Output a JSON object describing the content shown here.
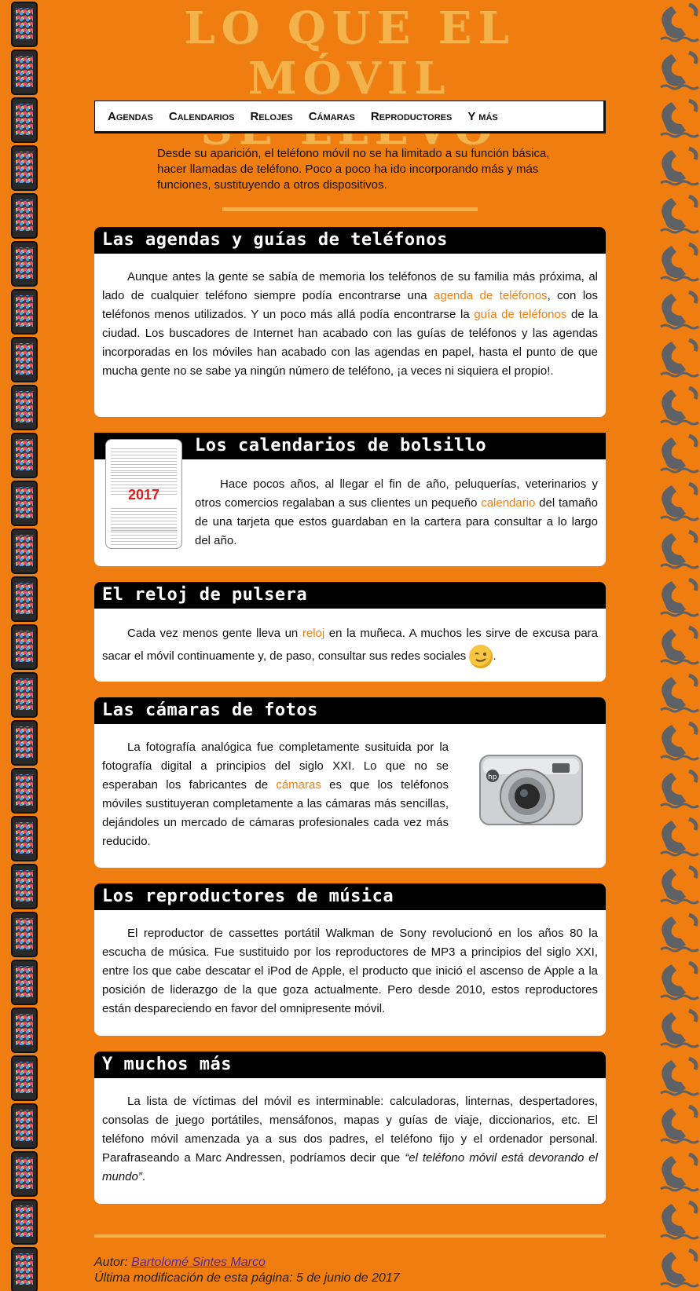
{
  "site": {
    "title_line1": "LO QUE EL MÓVIL",
    "title_line2": "SE LLEVÓ"
  },
  "nav": {
    "items": [
      "Agendas",
      "Calendarios",
      "Relojes",
      "Cámaras",
      "Reproductores",
      "Y más"
    ]
  },
  "intro": "Desde su aparición, el teléfono móvil no se ha limitado a su función básica, hacer llamadas de teléfono. Poco a poco ha ido incorporando más y más funciones, sustituyendo a otros dispositivos.",
  "sections": {
    "agendas": {
      "title": "Las agendas y guías de teléfonos",
      "t1": "Aunque antes la gente se sabía de memoria los teléfonos de su familia más próxima, al lado de cualquier teléfono siempre podía encontrarse una ",
      "link1": "agenda de teléfonos",
      "t2": ", con los teléfonos menos utilizados. Y un poco más allá podía encontrarse la ",
      "link2": "guía de teléfonos",
      "t3": " de la ciudad. Los buscadores de Internet han acabado con las guías de teléfonos y las agendas incorporadas en los móviles han acabado con las agendas en papel, hasta el punto de que mucha gente no se sabe ya ningún número de teléfono, ¡a veces ni siquiera el propio!."
    },
    "calendarios": {
      "title": "Los calendarios de bolsillo",
      "image_year": "2017",
      "t1": "Hace pocos años, al llegar el fin de año, peluquerías, veterinarios y otros comercios regalaban a sus clientes un pequeño ",
      "link1": "calendario",
      "t2": " del tamaño de una tarjeta que estos guardaban en la cartera para consultar a lo largo del año."
    },
    "relojes": {
      "title": "El reloj de pulsera",
      "t1": "Cada vez menos gente lleva un ",
      "link1": "reloj",
      "t2": " en la muñeca. A muchos les sirve de excusa para sacar el móvil continuamente y, de paso, consultar sus redes sociales ",
      "t3": "."
    },
    "camaras": {
      "title": "Las cámaras de fotos",
      "t1": "La fotografía analógica fue completamente susituida por la fotografía digital a principios del siglo XXI. Lo que no se esperaban los fabricantes de ",
      "link1": "cámaras",
      "t2": " es que los teléfonos móviles sustituyeran completamente a las cámaras más sencillas, dejándoles un mercado de cámaras profesionales cada vez más reducido."
    },
    "reproductores": {
      "title": "Los reproductores de música",
      "text": "El reproductor de cassettes portátil Walkman de Sony revolucionó en los años 80 la escucha de música. Fue sustituido por los reproductores de MP3 a principios del siglo XXI, entre los que cabe descatar el iPod de Apple, el producto que inició el ascenso de Apple a la posición de liderazgo de la que goza actualmente. Pero desde 2010, estos reproductores están despareciendo en favor del omnipresente móvil."
    },
    "mas": {
      "title": "Y muchos más",
      "t1": "La lista de víctimas del móvil es interminable: calculadoras, linternas, despertadores, consolas de juego portátiles, mensáfonos, mapas y guías de viaje, diccionarios, etc. El teléfono móvil amenzada ya a sus dos padres, el teléfono fijo y el ordenador personal. Parafraseando a Marc Andressen, podríamos decir que ",
      "quote": "“el teléfono móvil está devorando el mundo”",
      "t2": "."
    }
  },
  "footer": {
    "author_label": "Autor: ",
    "author_name": "Bartolomé Sintes Marco",
    "modified": "Última modificación de esta página: 5 de junio de 2017"
  },
  "colors": {
    "background": "#f07d0f",
    "title": "#f3b24a",
    "link": "#f07d0f"
  }
}
